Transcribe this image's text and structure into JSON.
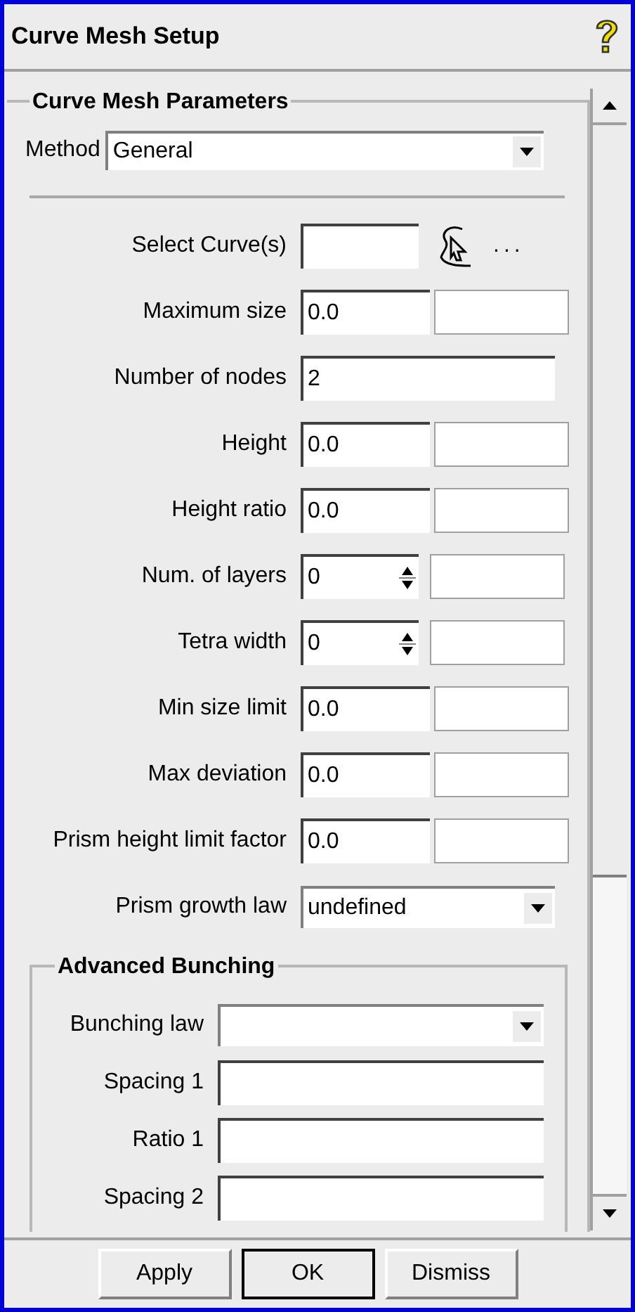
{
  "window": {
    "title": "Curve Mesh Setup"
  },
  "parameters": {
    "title": "Curve Mesh Parameters",
    "method": {
      "label": "Method",
      "value": "General"
    },
    "rows": [
      {
        "kind": "pick",
        "label": "Select Curve(s)",
        "value": "",
        "extra": "..."
      },
      {
        "kind": "pair",
        "label": "Maximum size",
        "value": "0.0"
      },
      {
        "kind": "single",
        "label": "Number of nodes",
        "value": "2"
      },
      {
        "kind": "pair",
        "label": "Height",
        "value": "0.0"
      },
      {
        "kind": "pair",
        "label": "Height ratio",
        "value": "0.0"
      },
      {
        "kind": "spin",
        "label": "Num. of layers",
        "value": "0"
      },
      {
        "kind": "spin",
        "label": "Tetra width",
        "value": "0"
      },
      {
        "kind": "pair",
        "label": "Min size limit",
        "value": "0.0"
      },
      {
        "kind": "pair",
        "label": "Max deviation",
        "value": "0.0"
      },
      {
        "kind": "pair",
        "label": "Prism height limit factor",
        "value": "0.0"
      },
      {
        "kind": "dropdown",
        "label": "Prism growth law",
        "value": "undefined"
      }
    ]
  },
  "advanced_bunching": {
    "title": "Advanced Bunching",
    "rows": [
      {
        "kind": "dropdown",
        "label": "Bunching law",
        "value": ""
      },
      {
        "kind": "single",
        "label": "Spacing 1",
        "value": ""
      },
      {
        "kind": "single",
        "label": "Ratio 1",
        "value": ""
      },
      {
        "kind": "single",
        "label": "Spacing 2",
        "value": ""
      }
    ]
  },
  "buttons": [
    {
      "label": "Apply",
      "focused": false
    },
    {
      "label": "OK",
      "focused": true
    },
    {
      "label": "Dismiss",
      "focused": false
    }
  ]
}
